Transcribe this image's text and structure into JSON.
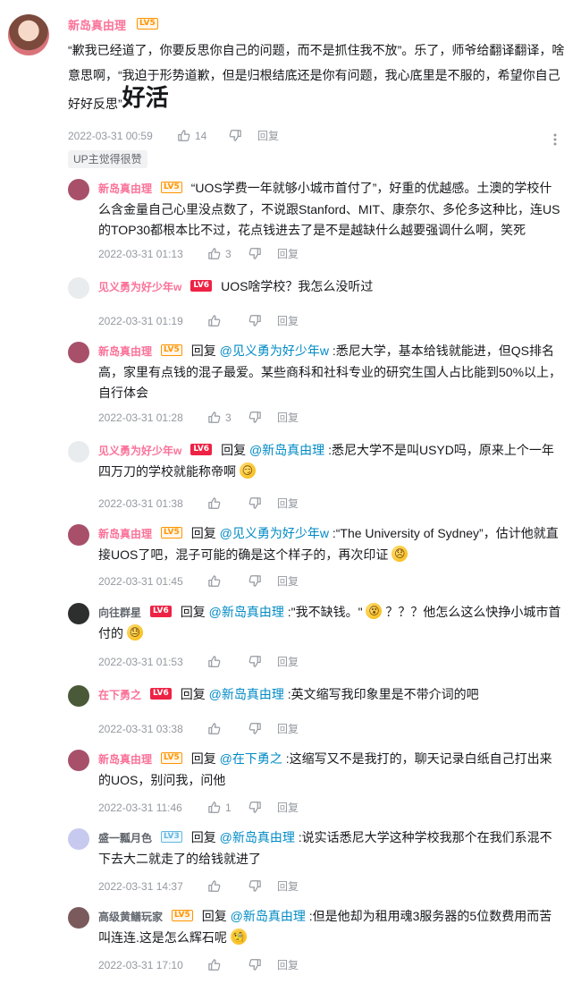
{
  "main_comment": {
    "username": "新岛真由理",
    "level": "LV5",
    "text_before": "“歉我已经道了，你要反思你自己的问题，而不是抓住我不放”。乐了，师爷给翻译翻译，啥意思啊，“我迫于形势道歉，但是归根结底还是你有问题，我心底里是不服的，希望你自己好好反思”",
    "text_big": "好活",
    "timestamp": "2022-03-31 00:59",
    "likes": "14",
    "reply_label": "回复",
    "up_badge": "UP主觉得很赞"
  },
  "replies": [
    {
      "username": "新岛真由理",
      "level": "LV5",
      "reply_prefix": "",
      "mention": "",
      "text": "“UOS学费一年就够小城市首付了”，好重的优越感。土澳的学校什么含金量自己心里没点数了，不说跟Stanford、MIT、康奈尔、多伦多这种比，连US的TOP30都根本比不过，花点钱进去了是不是越缺什么越要强调什么啊，笑死",
      "emoji": "",
      "timestamp": "2022-03-31 01:13",
      "likes": "3",
      "reply_label": "回复"
    },
    {
      "username": "见义勇为好少年w",
      "level": "LV6",
      "reply_prefix": "",
      "mention": "",
      "text": "UOS啥学校？我怎么没听过",
      "emoji": "",
      "timestamp": "2022-03-31 01:19",
      "likes": "",
      "reply_label": "回复"
    },
    {
      "username": "新岛真由理",
      "level": "LV5",
      "reply_prefix": "回复",
      "mention": "@见义勇为好少年w",
      "text": ":悉尼大学，基本给钱就能进，但QS排名高，家里有点钱的混子最爱。某些商科和社科专业的研究生国人占比能到50%以上，自行体会",
      "emoji": "",
      "timestamp": "2022-03-31 01:28",
      "likes": "3",
      "reply_label": "回复"
    },
    {
      "username": "见义勇为好少年w",
      "level": "LV6",
      "reply_prefix": "回复",
      "mention": "@新岛真由理",
      "text": ":悉尼大学不是叫USYD吗，原来上个一年四万刀的学校就能称帝啊",
      "emoji": "😏",
      "timestamp": "2022-03-31 01:38",
      "likes": "",
      "reply_label": "回复"
    },
    {
      "username": "新岛真由理",
      "level": "LV5",
      "reply_prefix": "回复",
      "mention": "@见义勇为好少年w",
      "text": ":“The University of Sydney”，估计他就直接UOS了吧，混子可能的确是这个样子的，再次印证",
      "emoji": "😞",
      "timestamp": "2022-03-31 01:45",
      "likes": "",
      "reply_label": "回复"
    },
    {
      "username": "向往群星",
      "level": "LV6",
      "reply_prefix": "回复",
      "mention": "@新岛真由理",
      "text": ":\"我不缺钱。\"",
      "text2": "？？？他怎么这么快挣小城市首付的",
      "emoji": "😵",
      "emoji2": "😓",
      "timestamp": "2022-03-31 01:53",
      "likes": "",
      "reply_label": "回复"
    },
    {
      "username": "在下勇之",
      "level": "LV6",
      "reply_prefix": "回复",
      "mention": "@新岛真由理",
      "text": ":英文缩写我印象里是不带介词的吧",
      "emoji": "",
      "timestamp": "2022-03-31 03:38",
      "likes": "",
      "reply_label": "回复"
    },
    {
      "username": "新岛真由理",
      "level": "LV5",
      "reply_prefix": "回复",
      "mention": "@在下勇之",
      "text": ":这缩写又不是我打的，聊天记录白纸自己打出来的UOS，别问我，问他",
      "emoji": "",
      "timestamp": "2022-03-31 11:46",
      "likes": "1",
      "reply_label": "回复"
    },
    {
      "username": "盛一瓢月色",
      "level": "LV3",
      "reply_prefix": "回复",
      "mention": "@新岛真由理",
      "text": ":说实话悉尼大学这种学校我那个在我们系混不下去大二就走了的给钱就进了",
      "emoji": "",
      "timestamp": "2022-03-31 14:37",
      "likes": "",
      "reply_label": "回复"
    },
    {
      "username": "高级黄鳝玩家",
      "level": "LV5",
      "reply_prefix": "回复",
      "mention": "@新岛真由理",
      "text": ":但是他却为租用魂3服务器的5位数费用而苦叫连连.这是怎么辉石呢",
      "emoji": "🧐",
      "timestamp": "2022-03-31 17:10",
      "likes": "",
      "reply_label": "回复"
    }
  ],
  "colors": {
    "username_pink": "#fb7299",
    "username_gray": "#61666d",
    "mention_blue": "#008ac5",
    "meta_gray": "#9499a0",
    "lv5": "#ff9500",
    "lv6": "#ee2244",
    "lv3": "#62b7e0"
  },
  "icons": [
    "thumb-up-icon",
    "thumb-down-icon",
    "more-vertical-icon"
  ]
}
